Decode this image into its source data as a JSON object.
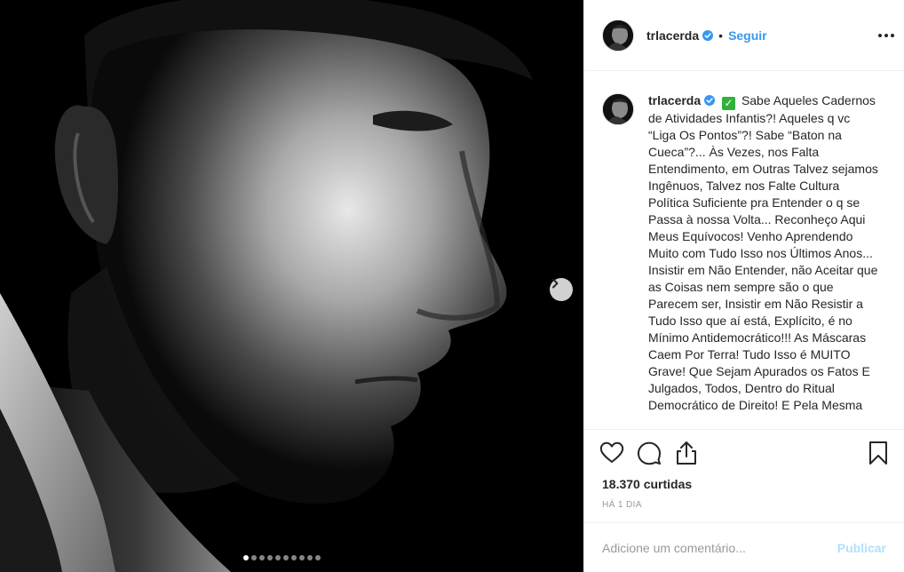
{
  "post": {
    "media": {
      "image_description_icon": "profile-photo",
      "slide_count": 10,
      "active_slide": 1
    },
    "header": {
      "username": "trlacerda",
      "separator": "•",
      "follow_label": "Seguir"
    },
    "caption": {
      "username": "trlacerda",
      "emoji": "✓",
      "text": "Sabe Aqueles Cadernos de Atividades Infantis?! Aqueles q vc “Liga Os Pontos”?! Sabe “Baton na Cueca”?... Às Vezes, nos Falta Entendimento, em Outras Talvez sejamos Ingênuos, Talvez nos Falte Cultura Política Suficiente pra Entender o q se Passa à nossa Volta... Reconheço Aqui Meus Equívocos! Venho Aprendendo Muito com Tudo Isso nos Últimos Anos... Insistir em Não Entender, não Aceitar que as Coisas nem sempre são o que Parecem ser, Insistir em Não Resistir a Tudo Isso que aí está, Explícito, é no Mínimo Antidemocrático!!! As Máscaras Caem Por Terra! Tudo Isso é MUITO Grave! Que Sejam Apurados os Fatos E Julgados, Todos, Dentro do Ritual Democrático de Direito! E Pela Mesma"
    },
    "likes": "18.370 curtidas",
    "time": "HÁ 1 DIA",
    "comment": {
      "placeholder": "Adicione um comentário...",
      "publish_label": "Publicar"
    },
    "colors": {
      "link_blue": "#3897f0",
      "publish_disabled": "#b2dffc",
      "verified_blue": "#3897f0"
    }
  }
}
